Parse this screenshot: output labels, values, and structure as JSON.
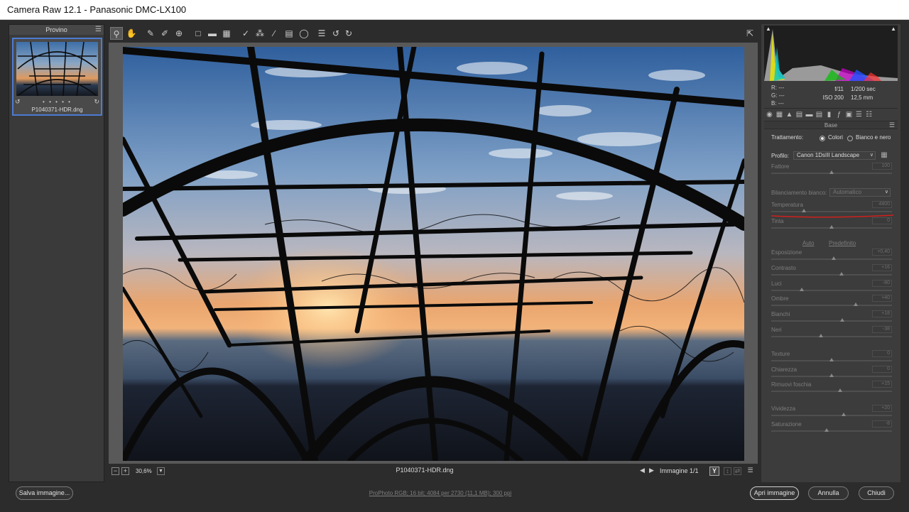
{
  "window": {
    "title": "Camera Raw 12.1  -  Panasonic DMC-LX100"
  },
  "filmstrip": {
    "header": "Provino",
    "menu_icon": "menu-icon",
    "thumbnail": {
      "filename": "P1040371-HDR.dng",
      "rating_dots": "• • • • •"
    }
  },
  "toolbar": {
    "tools": [
      "zoom-icon",
      "hand-icon",
      "white-balance-icon",
      "color-sampler-icon",
      "target-adjust-icon",
      "crop-icon",
      "straighten-icon",
      "transform-icon",
      "spot-removal-icon",
      "red-eye-icon",
      "adjustment-brush-icon",
      "graduated-filter-icon",
      "radial-filter-icon",
      "preferences-icon",
      "rotate-left-icon",
      "rotate-right-icon"
    ],
    "fullscreen_icon": "fullscreen-icon"
  },
  "preview": {
    "zoom": "30,6%",
    "filename": "P1040371-HDR.dng",
    "image_count": "Immagine 1/1",
    "y_button": "Y"
  },
  "histogram": {
    "rgb": {
      "r_label": "R:",
      "g_label": "G:",
      "b_label": "B:",
      "r": "---",
      "g": "---",
      "b": "---"
    },
    "exif": {
      "aperture": "f/11",
      "shutter": "1/200 sec",
      "iso": "ISO 200",
      "focal": "12,5 mm"
    }
  },
  "panel": {
    "section_title": "Base",
    "trattamento_label": "Trattamento:",
    "colori_label": "Colori",
    "bn_label": "Bianco e nero",
    "profilo_label": "Profilo:",
    "profilo_value": "Canon 1DsIII Landscape",
    "wb_label": "Bilanciamento bianco:",
    "wb_value": "Automatico",
    "auto_link": "Auto",
    "default_link": "Predefinito",
    "sliders": [
      {
        "label": "Fattore",
        "value": "100",
        "level": 0.5
      },
      {
        "label": "Temperatura",
        "value": "4800",
        "level": 0.27
      },
      {
        "label": "Tinta",
        "value": "0",
        "level": 0.5
      },
      {
        "label": "Esposizione",
        "value": "+0,40",
        "level": 0.52
      },
      {
        "label": "Contrasto",
        "value": "+16",
        "level": 0.58
      },
      {
        "label": "Luci",
        "value": "-80",
        "level": 0.25
      },
      {
        "label": "Ombre",
        "value": "+40",
        "level": 0.7
      },
      {
        "label": "Bianchi",
        "value": "+18",
        "level": 0.59
      },
      {
        "label": "Neri",
        "value": "-38",
        "level": 0.41
      },
      {
        "label": "Texture",
        "value": "0",
        "level": 0.5
      },
      {
        "label": "Chiarezza",
        "value": "0",
        "level": 0.5
      },
      {
        "label": "Rimuovi foschia",
        "value": "+15",
        "level": 0.57
      },
      {
        "label": "Vividezza",
        "value": "+20",
        "level": 0.6
      },
      {
        "label": "Saturazione",
        "value": "-8",
        "level": 0.46
      }
    ]
  },
  "bottom": {
    "save": "Salva immagine...",
    "workflow": "ProPhoto RGB; 16 bit; 4084 per 2730 (11,1 MB); 300 ppi",
    "open": "Apri immagine",
    "cancel": "Annulla",
    "done": "Chiudi"
  },
  "colors": {
    "accent": "#4d7bd1",
    "annotation": "#d0201c"
  }
}
